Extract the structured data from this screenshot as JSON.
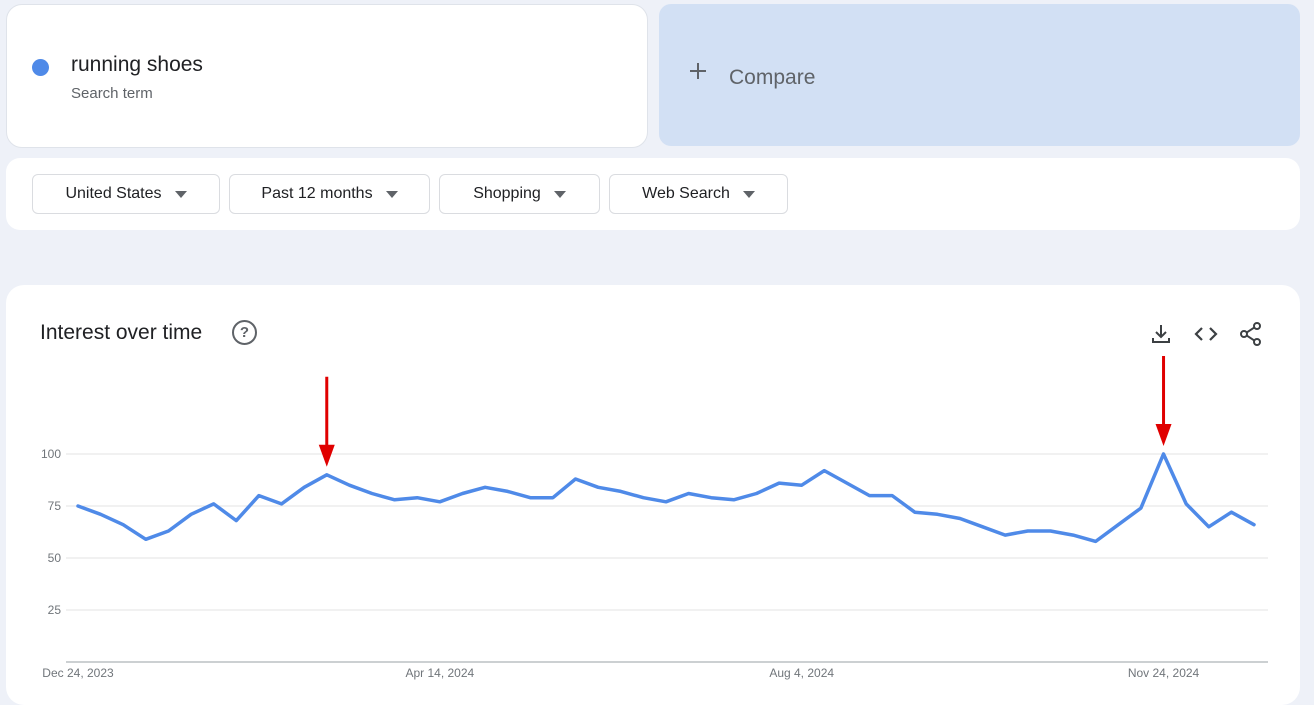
{
  "search_term": {
    "name": "running shoes",
    "subtitle": "Search term",
    "color": "#4f8ae8"
  },
  "compare": {
    "label": "Compare",
    "icon": "plus-icon"
  },
  "filters": [
    {
      "label": "United States"
    },
    {
      "label": "Past 12 months"
    },
    {
      "label": "Shopping"
    },
    {
      "label": "Web Search"
    }
  ],
  "chart_card": {
    "title": "Interest over time",
    "icons": [
      "help-icon",
      "download-icon",
      "embed-icon",
      "share-icon"
    ]
  },
  "chart_data": {
    "type": "line",
    "title": "",
    "xlabel": "",
    "ylabel": "",
    "ylim": [
      0,
      100
    ],
    "yticks": [
      25,
      50,
      75,
      100
    ],
    "grid": true,
    "x_tick_labels": [
      {
        "label": "Dec 24, 2023",
        "index": 0
      },
      {
        "label": "Apr 14, 2024",
        "index": 16
      },
      {
        "label": "Aug 4, 2024",
        "index": 32
      },
      {
        "label": "Nov 24, 2024",
        "index": 48
      }
    ],
    "series": [
      {
        "name": "",
        "color": "#4f8ae8",
        "values": [
          75,
          71,
          66,
          59,
          63,
          71,
          76,
          68,
          80,
          76,
          84,
          90,
          85,
          81,
          78,
          79,
          77,
          81,
          84,
          82,
          79,
          79,
          88,
          84,
          82,
          79,
          77,
          81,
          79,
          78,
          81,
          86,
          85,
          92,
          86,
          80,
          80,
          72,
          71,
          69,
          65,
          61,
          63,
          63,
          61,
          58,
          66,
          74,
          100,
          76,
          65,
          72,
          66
        ]
      }
    ],
    "annotations": [
      {
        "type": "arrow",
        "color": "#e00000",
        "target_index": 11
      },
      {
        "type": "arrow",
        "color": "#e00000",
        "target_index": 48
      }
    ]
  }
}
